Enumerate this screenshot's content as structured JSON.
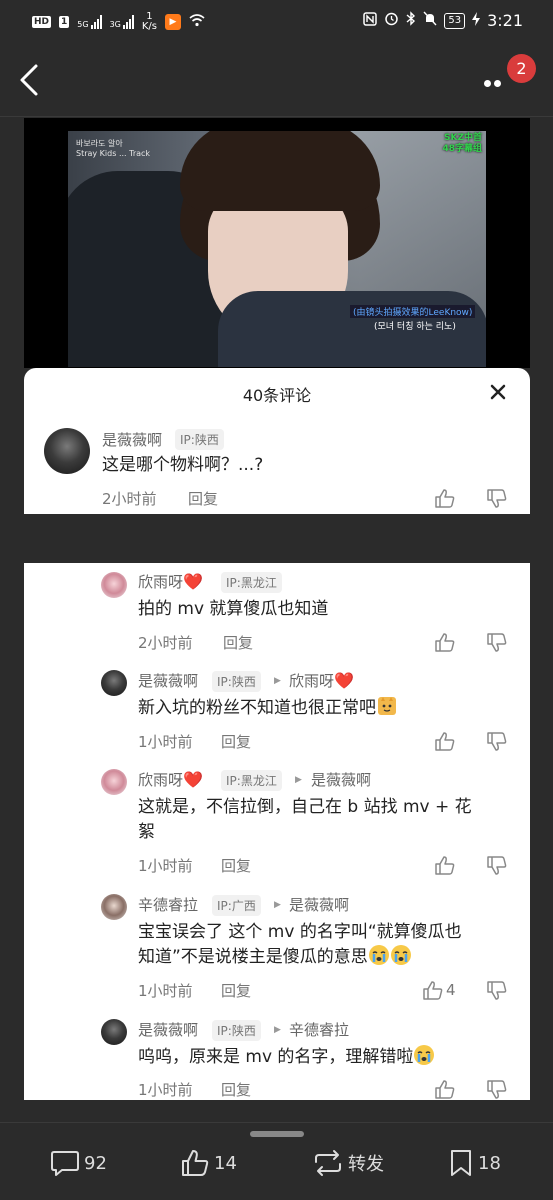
{
  "status_bar": {
    "hd_badge": "HD",
    "sim1": "1",
    "net1": "5G",
    "net2": "3G",
    "speed_value": "1",
    "speed_unit": "K/s",
    "battery": "53",
    "time": "3:21"
  },
  "header": {
    "notification_count": "2"
  },
  "video": {
    "watermark_line1": "바보라도 알아",
    "watermark_line2": "Stray Kids ... Track",
    "subtitle_group_line1": "SKZ中首",
    "subtitle_group_line2": "48字幕组",
    "caption_cn": "(由镜头拍摄效果的LeeKnow)",
    "caption_kr": "(모녀 터칭 하는 리노)"
  },
  "panel": {
    "title": "40条评论"
  },
  "main_comment": {
    "user": "是薇薇啊",
    "ip": "IP:陕西",
    "text": "这是哪个物料啊？...?",
    "time": "2小时前",
    "reply_label": "回复"
  },
  "replies": [
    {
      "user": "欣雨呀",
      "heart": "❤️",
      "ip": "IP:黑龙江",
      "reply_to": "",
      "lines": [
        "拍的 mv 就算傻瓜也知道"
      ],
      "time": "2小时前",
      "reply_label": "回复",
      "likes": ""
    },
    {
      "user": "是薇薇啊",
      "heart": "",
      "ip": "IP:陕西",
      "reply_to": "欣雨呀",
      "reply_to_heart": "❤️",
      "lines": [
        "新入坑的粉丝不知道也很正常吧"
      ],
      "time": "1小时前",
      "reply_label": "回复",
      "likes": ""
    },
    {
      "user": "欣雨呀",
      "heart": "❤️",
      "ip": "IP:黑龙江",
      "reply_to": "是薇薇啊",
      "lines": [
        "这就是，不信拉倒，自己在 b 站找 mv + 花",
        "絮"
      ],
      "time": "1小时前",
      "reply_label": "回复",
      "likes": ""
    },
    {
      "user": "辛德睿拉",
      "heart": "",
      "ip": "IP:广西",
      "reply_to": "是薇薇啊",
      "lines": [
        "宝宝误会了 这个 mv 的名字叫“就算傻瓜也",
        "知道”不是说楼主是傻瓜的意思"
      ],
      "time": "1小时前",
      "reply_label": "回复",
      "likes": "4"
    },
    {
      "user": "是薇薇啊",
      "heart": "",
      "ip": "IP:陕西",
      "reply_to": "辛德睿拉",
      "lines": [
        "呜呜，原来是 mv 的名字，理解错啦"
      ],
      "time": "1小时前",
      "reply_label": "回复",
      "likes": ""
    }
  ],
  "bottom_bar": {
    "comments_count": "92",
    "likes_count": "14",
    "share_label": "转发",
    "favorites_count": "18"
  },
  "colors": {
    "dark_bg": "#2b2b2b",
    "heart": "#e0323a",
    "badge": "#d93c3c"
  }
}
